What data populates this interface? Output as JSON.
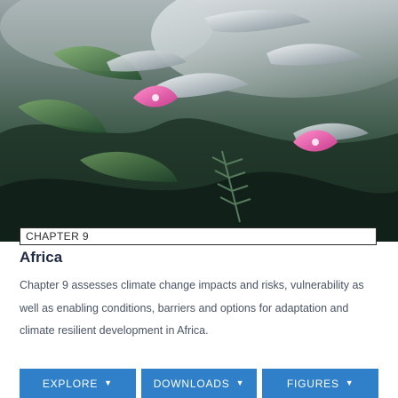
{
  "chapter": {
    "label": "CHAPTER 9",
    "title": "Africa",
    "description": "Chapter 9 assesses climate change impacts and risks, vulnerability as well as enabling conditions, barriers and options for adaptation and climate resilient development in Africa."
  },
  "buttons": [
    {
      "label": "EXPLORE",
      "icon": "chevron-down-icon"
    },
    {
      "label": "DOWNLOADS",
      "icon": "chevron-down-icon"
    },
    {
      "label": "FIGURES",
      "icon": "chevron-down-icon"
    }
  ],
  "colors": {
    "button_blue": "#2f80c8",
    "title_navy": "#1f2a44",
    "body_text": "#4a5366"
  }
}
